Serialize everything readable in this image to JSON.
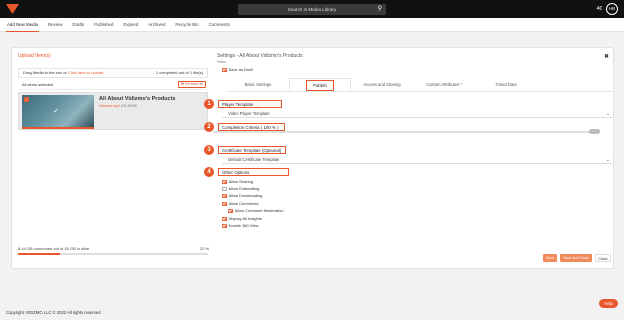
{
  "topbar": {
    "logo": "vidizmo-logo",
    "search_placeholder": "Search in Media Library",
    "search_icon": "search-icon",
    "user_initials": "HB",
    "language": "4€"
  },
  "subnav": {
    "tabs": [
      "Add New Media",
      "Review",
      "Drafts",
      "Published",
      "Expired",
      "Archived",
      "Recycle Bin",
      "Comments"
    ],
    "active_index": 0
  },
  "upload": {
    "title": "Upload Item(s)",
    "drop_prefix": "Drag Media in the box or ",
    "drop_link": "Click here to upload",
    "completed": "1 completed out of 1 file(s)",
    "selected": "All items selected",
    "remove_all": "✖ Remove all",
    "item_title": "All About Vidizmo's Products",
    "item_sub_link": "Vidizmo.mp4",
    "item_sub_duration": " | 01:10:00",
    "storage_text": "8.44 GB consumed out of 40 GB in slice",
    "storage_pct": "22 %",
    "storage_fraction": 0.22
  },
  "settings": {
    "title": "Settings - All About Vidizmo's Products",
    "sub": "Video",
    "save_draft": "Save as Draft",
    "tabs": [
      "Basic Settings",
      "Publish",
      "Access and Sharing",
      "Custom Attributes *",
      "Timed Data"
    ],
    "active_tab": 1,
    "sections": [
      {
        "num": "1",
        "label": "Player Template",
        "value": "Video Player Template"
      },
      {
        "num": "2",
        "label": "Completion Criteria ( 100 % )"
      },
      {
        "num": "3",
        "label": "Certificate Template (Optional)",
        "value": "Default Certificate Template"
      },
      {
        "num": "4",
        "label": "Other Options"
      }
    ],
    "options": [
      {
        "label": "Allow Sharing",
        "checked": true
      },
      {
        "label": "Allow Embedding",
        "checked": false
      },
      {
        "label": "Allow Downloading",
        "checked": true
      },
      {
        "label": "Allow Comments",
        "checked": true
      },
      {
        "label": "Allow Comment Moderation",
        "checked": true
      },
      {
        "label": "Display All Insights",
        "checked": true
      },
      {
        "label": "Enable 360 View",
        "checked": true
      }
    ]
  },
  "actions": {
    "save": "Save",
    "save_close": "Save And Close",
    "close": "Close"
  },
  "footer": "Copyright VIDIZMO LLC © 2022 All rights reserved",
  "help": "Help",
  "colors": {
    "accent": "#e8562a",
    "topbar": "#111111"
  }
}
